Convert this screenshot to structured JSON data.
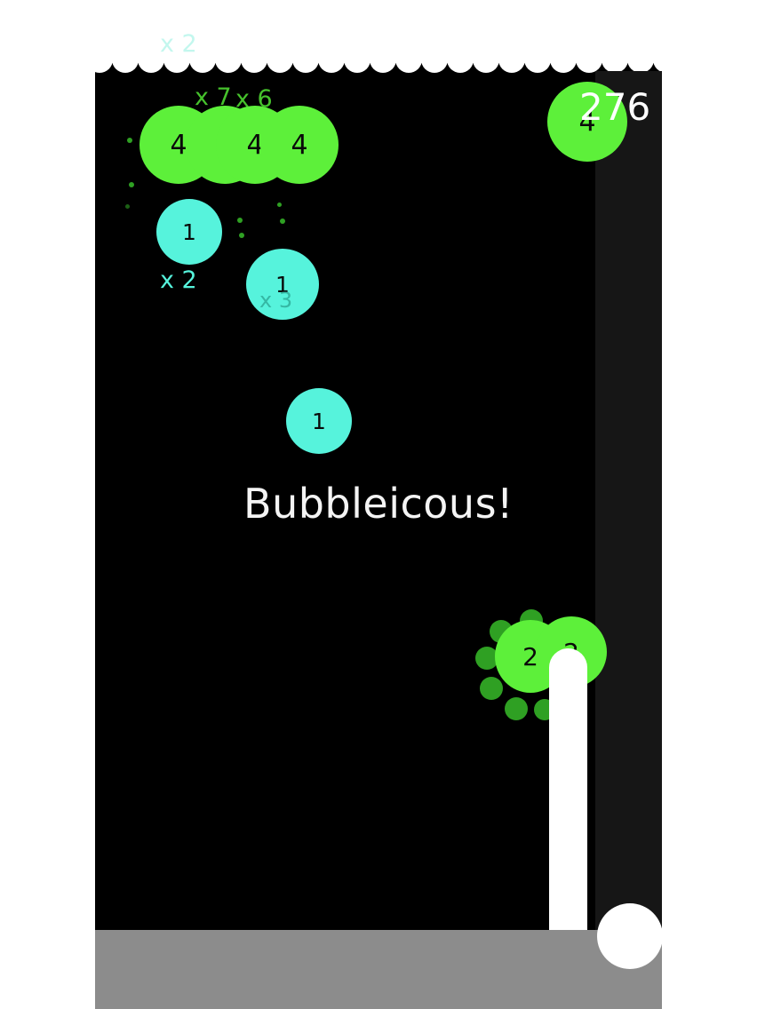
{
  "hud": {
    "score": "276"
  },
  "message": "Bubbleicous!",
  "multipliers": {
    "top": "x 2",
    "cluster_a": "x 7",
    "cluster_b": "x 6",
    "left": "x 2",
    "faint": "x 3"
  },
  "bubbles": {
    "cluster_1": "4",
    "cluster_2": "4",
    "cluster_3": "4",
    "top_right": "4",
    "cyan_1": "1",
    "cyan_2": "1",
    "cyan_3": "1",
    "launcher_a": "2",
    "launcher_b": "2"
  },
  "colors": {
    "background": "#000000",
    "green_bubble": "#5df03a",
    "cyan_bubble": "#56f3dc",
    "floor": "#8c8c8c",
    "text": "#ffffff"
  }
}
